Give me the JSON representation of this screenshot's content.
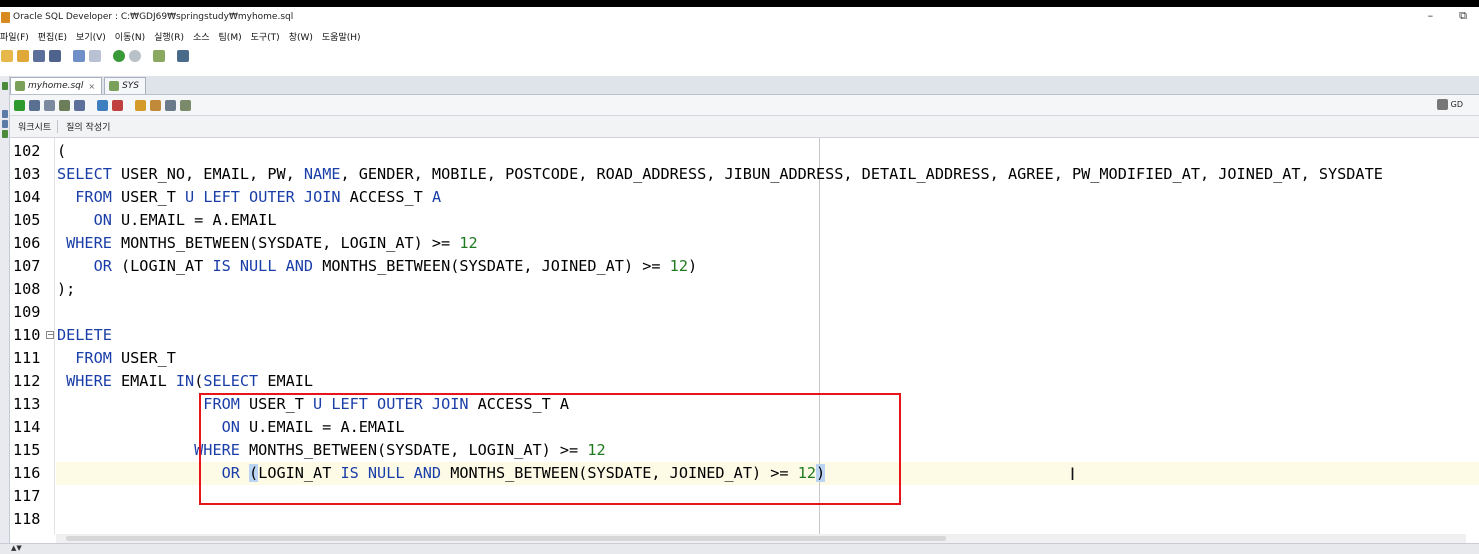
{
  "window": {
    "title": "Oracle SQL Developer : C:₩GDJ69₩springstudy₩myhome.sql",
    "controls": [
      "–",
      "⧉"
    ]
  },
  "menu": [
    "파일(F)",
    "편집(E)",
    "보기(V)",
    "이동(N)",
    "실행(R)",
    "소스",
    "팀(M)",
    "도구(T)",
    "창(W)",
    "도움말(H)"
  ],
  "tabs": [
    {
      "label": "myhome.sql",
      "close": "×",
      "active": true
    },
    {
      "label": "SYS",
      "close": "×",
      "active": false
    }
  ],
  "connection": {
    "label": "GD"
  },
  "subtabs": [
    "워크시트",
    "질의 작성기"
  ],
  "editor": {
    "lines": [
      {
        "n": "102",
        "tokens": [
          [
            "(",
            "t"
          ]
        ]
      },
      {
        "n": "103",
        "tokens": [
          [
            "SELECT",
            "k"
          ],
          [
            " USER_NO, EMAIL, PW, ",
            "t"
          ],
          [
            "NAME",
            "k"
          ],
          [
            ", GENDER, MOBILE, POSTCODE, ROAD_ADDRESS, JIBUN_ADDRESS, DETAIL_ADDRESS, AGREE, PW_MODIFIED_AT, JOINED_AT, SYSDATE",
            "t"
          ]
        ]
      },
      {
        "n": "104",
        "tokens": [
          [
            "  FROM",
            "k"
          ],
          [
            " USER_T ",
            "t"
          ],
          [
            "U",
            "k"
          ],
          [
            " ",
            "t"
          ],
          [
            "LEFT OUTER JOIN",
            "k"
          ],
          [
            " ACCESS_T ",
            "t"
          ],
          [
            "A",
            "k"
          ]
        ]
      },
      {
        "n": "105",
        "tokens": [
          [
            "    ON",
            "k"
          ],
          [
            " U.EMAIL = A.EMAIL",
            "t"
          ]
        ]
      },
      {
        "n": "106",
        "tokens": [
          [
            " WHERE",
            "k"
          ],
          [
            " MONTHS_BETWEEN(SYSDATE, LOGIN_AT) >= ",
            "t"
          ],
          [
            "12",
            "n"
          ]
        ]
      },
      {
        "n": "107",
        "tokens": [
          [
            "    OR",
            "k"
          ],
          [
            " (LOGIN_AT ",
            "t"
          ],
          [
            "IS NULL AND",
            "k"
          ],
          [
            " MONTHS_BETWEEN(SYSDATE, JOINED_AT) >= ",
            "t"
          ],
          [
            "12",
            "n"
          ],
          [
            ")",
            "t"
          ]
        ]
      },
      {
        "n": "108",
        "tokens": [
          [
            ");",
            "t"
          ]
        ]
      },
      {
        "n": "109",
        "tokens": []
      },
      {
        "n": "110",
        "tokens": [
          [
            "DELETE",
            "k"
          ]
        ],
        "fold": "−"
      },
      {
        "n": "111",
        "tokens": [
          [
            "  FROM",
            "k"
          ],
          [
            " USER_T",
            "t"
          ]
        ]
      },
      {
        "n": "112",
        "tokens": [
          [
            " WHERE",
            "k"
          ],
          [
            " EMAIL ",
            "t"
          ],
          [
            "IN",
            "k"
          ],
          [
            "(",
            "t"
          ],
          [
            "SELECT",
            "k"
          ],
          [
            " EMAIL",
            "t"
          ]
        ]
      },
      {
        "n": "113",
        "tokens": [
          [
            "                FROM",
            "k"
          ],
          [
            " USER_T ",
            "t"
          ],
          [
            "U",
            "k"
          ],
          [
            " ",
            "t"
          ],
          [
            "LEFT OUTER JOIN",
            "k"
          ],
          [
            " ACCESS_T A",
            "t"
          ]
        ]
      },
      {
        "n": "114",
        "tokens": [
          [
            "                  ON",
            "k"
          ],
          [
            " U.EMAIL = A.EMAIL",
            "t"
          ]
        ]
      },
      {
        "n": "115",
        "tokens": [
          [
            "               WHERE",
            "k"
          ],
          [
            " MONTHS_BETWEEN(SYSDATE, LOGIN_AT) >= ",
            "t"
          ],
          [
            "12",
            "n"
          ]
        ]
      },
      {
        "n": "116",
        "tokens": [
          [
            "                  OR",
            "k"
          ],
          [
            " ",
            "t"
          ],
          [
            "(",
            "h"
          ],
          [
            "LOGIN_AT ",
            "t"
          ],
          [
            "IS NULL AND",
            "k"
          ],
          [
            " MONTHS_BETWEEN(SYSDATE, JOINED_AT) >= ",
            "t"
          ],
          [
            "12",
            "n"
          ],
          [
            ")",
            "h"
          ]
        ]
      },
      {
        "n": "117",
        "tokens": []
      },
      {
        "n": "118",
        "tokens": []
      }
    ]
  },
  "cursor_glyph": "I",
  "bottom_arrows": "▲▼",
  "colors": {
    "keyword": "#1a3ea8",
    "number": "#1f7a1f",
    "annotation_box": "#e8141b",
    "bracket_highlight": "#bcd4f4"
  }
}
